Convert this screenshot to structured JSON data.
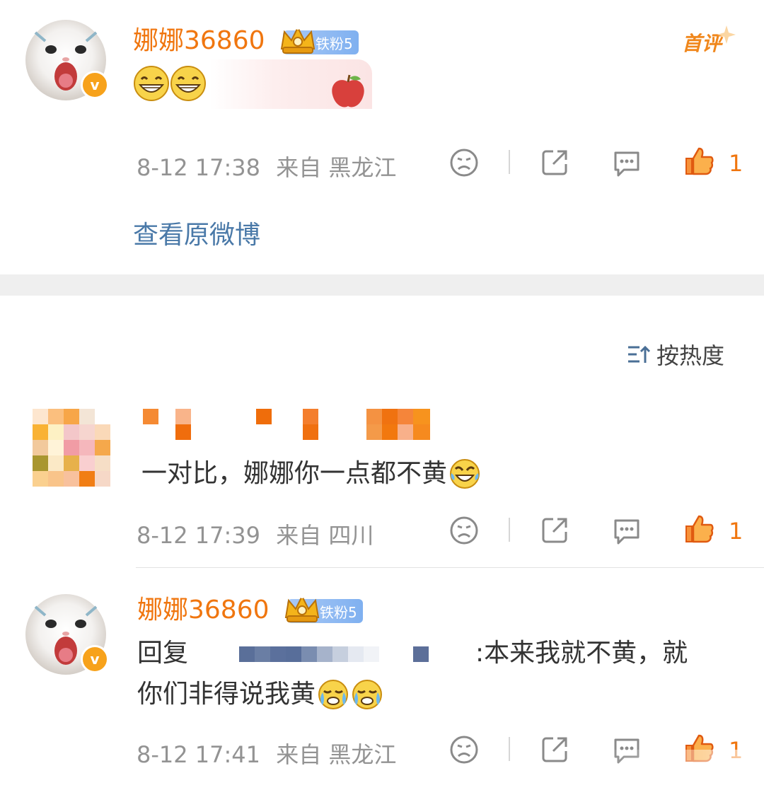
{
  "comment1": {
    "username": "娜娜36860",
    "fan_badge": "铁粉5",
    "first_tag": "首评",
    "time": "8-12 17:38",
    "location": "来自 黑龙江",
    "likes": "1"
  },
  "view_original": "查看原微博",
  "sort_label": "按热度",
  "comment2": {
    "text": "一对比，娜娜你一点都不黄",
    "time": "8-12 17:39",
    "location": "来自 四川",
    "likes": "1"
  },
  "comment3": {
    "username": "娜娜36860",
    "fan_badge": "铁粉5",
    "reply_prefix": "回复",
    "reply_line1": ":本来我就不黄，就",
    "reply_line2": "你们非得说我黄",
    "time": "8-12 17:41",
    "location": "来自 黑龙江",
    "likes": "1"
  },
  "colors": {
    "username": "#f0760f",
    "link": "#4a79a8",
    "meta": "#939393",
    "divider_band": "#efefef"
  }
}
